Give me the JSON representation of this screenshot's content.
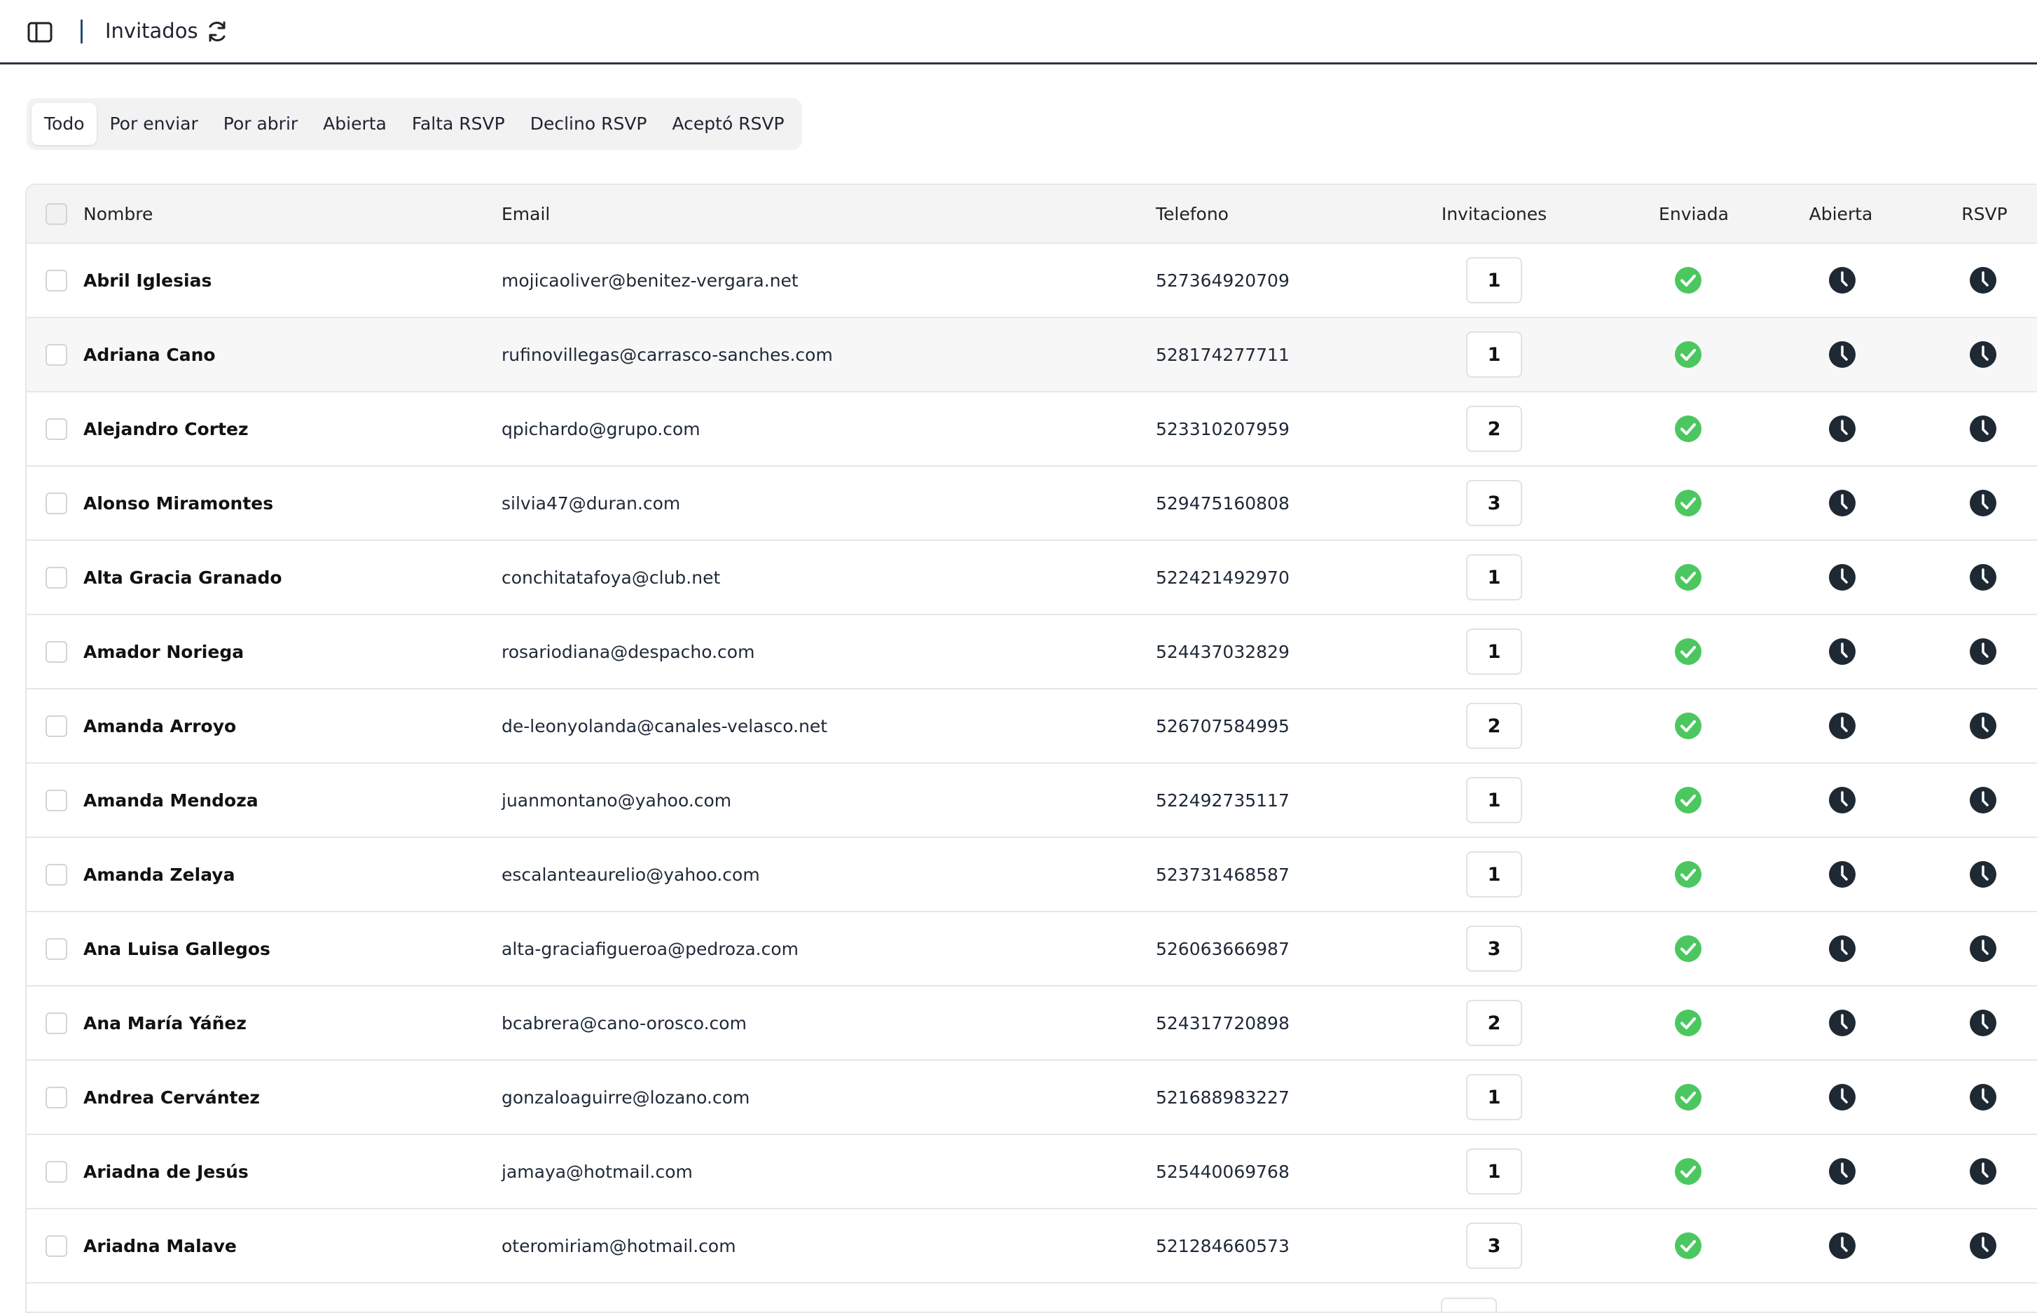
{
  "header": {
    "title": "Invitados"
  },
  "tabs": [
    {
      "label": "Todo",
      "active": true
    },
    {
      "label": "Por enviar",
      "active": false
    },
    {
      "label": "Por abrir",
      "active": false
    },
    {
      "label": "Abierta",
      "active": false
    },
    {
      "label": "Falta RSVP",
      "active": false
    },
    {
      "label": "Declino RSVP",
      "active": false
    },
    {
      "label": "Aceptó RSVP",
      "active": false
    }
  ],
  "table": {
    "columns": {
      "name": "Nombre",
      "email": "Email",
      "phone": "Telefono",
      "invitations": "Invitaciones",
      "sent": "Enviada",
      "opened": "Abierta",
      "rsvp": "RSVP"
    },
    "rows": [
      {
        "name": "Abril Iglesias",
        "email": "mojicaoliver@benitez-vergara.net",
        "phone": "527364920709",
        "invitations": "1",
        "sent": "check-circle-icon",
        "opened": "clock-icon",
        "rsvp": "clock-icon"
      },
      {
        "name": "Adriana Cano",
        "email": "rufinovillegas@carrasco-sanches.com",
        "phone": "528174277711",
        "invitations": "1",
        "sent": "check-circle-icon",
        "opened": "clock-icon",
        "rsvp": "clock-icon"
      },
      {
        "name": "Alejandro Cortez",
        "email": "qpichardo@grupo.com",
        "phone": "523310207959",
        "invitations": "2",
        "sent": "check-circle-icon",
        "opened": "clock-icon",
        "rsvp": "clock-icon"
      },
      {
        "name": "Alonso Miramontes",
        "email": "silvia47@duran.com",
        "phone": "529475160808",
        "invitations": "3",
        "sent": "check-circle-icon",
        "opened": "clock-icon",
        "rsvp": "clock-icon"
      },
      {
        "name": "Alta Gracia Granado",
        "email": "conchitatafoya@club.net",
        "phone": "522421492970",
        "invitations": "1",
        "sent": "check-circle-icon",
        "opened": "clock-icon",
        "rsvp": "clock-icon"
      },
      {
        "name": "Amador Noriega",
        "email": "rosariodiana@despacho.com",
        "phone": "524437032829",
        "invitations": "1",
        "sent": "check-circle-icon",
        "opened": "clock-icon",
        "rsvp": "clock-icon"
      },
      {
        "name": "Amanda Arroyo",
        "email": "de-leonyolanda@canales-velasco.net",
        "phone": "526707584995",
        "invitations": "2",
        "sent": "check-circle-icon",
        "opened": "clock-icon",
        "rsvp": "clock-icon"
      },
      {
        "name": "Amanda Mendoza",
        "email": "juanmontano@yahoo.com",
        "phone": "522492735117",
        "invitations": "1",
        "sent": "check-circle-icon",
        "opened": "clock-icon",
        "rsvp": "clock-icon"
      },
      {
        "name": "Amanda Zelaya",
        "email": "escalanteaurelio@yahoo.com",
        "phone": "523731468587",
        "invitations": "1",
        "sent": "check-circle-icon",
        "opened": "clock-icon",
        "rsvp": "clock-icon"
      },
      {
        "name": "Ana Luisa Gallegos",
        "email": "alta-graciafigueroa@pedroza.com",
        "phone": "526063666987",
        "invitations": "3",
        "sent": "check-circle-icon",
        "opened": "clock-icon",
        "rsvp": "clock-icon"
      },
      {
        "name": "Ana María Yáñez",
        "email": "bcabrera@cano-orosco.com",
        "phone": "524317720898",
        "invitations": "2",
        "sent": "check-circle-icon",
        "opened": "clock-icon",
        "rsvp": "clock-icon"
      },
      {
        "name": "Andrea Cervántez",
        "email": "gonzaloaguirre@lozano.com",
        "phone": "521688983227",
        "invitations": "1",
        "sent": "check-circle-icon",
        "opened": "clock-icon",
        "rsvp": "clock-icon"
      },
      {
        "name": "Ariadna de Jesús",
        "email": "jamaya@hotmail.com",
        "phone": "525440069768",
        "invitations": "1",
        "sent": "check-circle-icon",
        "opened": "clock-icon",
        "rsvp": "clock-icon"
      },
      {
        "name": "Ariadna Malave",
        "email": "oteromiriam@hotmail.com",
        "phone": "521284660573",
        "invitations": "3",
        "sent": "check-circle-icon",
        "opened": "clock-icon",
        "rsvp": "clock-icon"
      }
    ],
    "hovered_row": 1
  },
  "colors": {
    "sent_check": "#4cc760",
    "pending_clock": "#1f2933",
    "header_border": "#2b3442"
  }
}
